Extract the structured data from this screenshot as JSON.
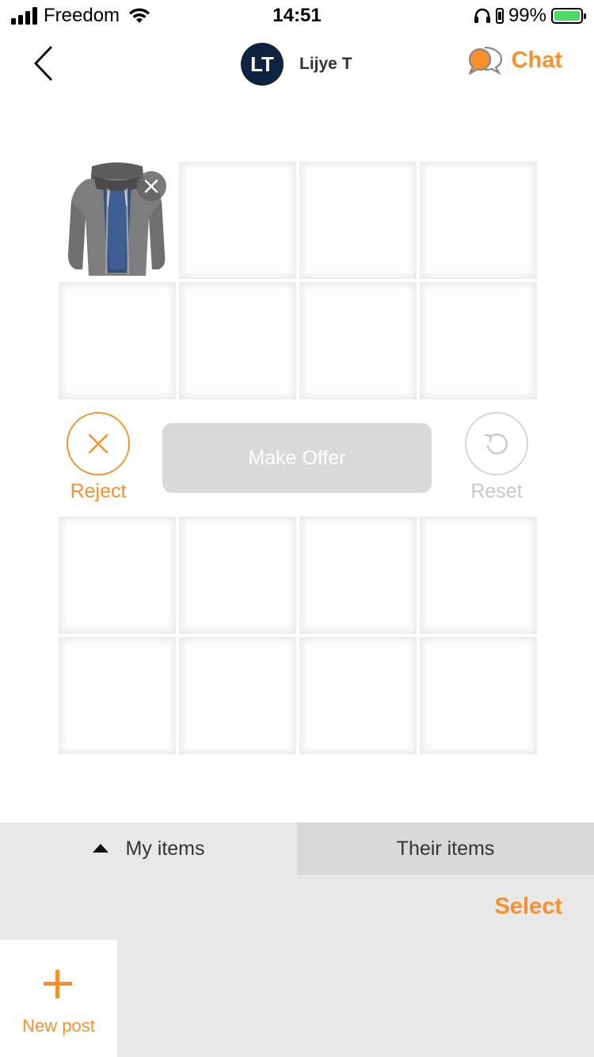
{
  "status_bar": {
    "carrier": "Freedom",
    "time": "14:51",
    "battery_percent": "99%",
    "battery_level": 0.99,
    "icons": [
      "signal-icon",
      "wifi-icon",
      "headphones-icon",
      "orientation-lock-icon",
      "battery-charging-icon"
    ]
  },
  "nav": {
    "back_icon": "chevron-left-icon",
    "avatar_initials": "LT",
    "user_name": "Lijye T",
    "chat_label": "Chat",
    "chat_icon": "chat-bubbles-icon"
  },
  "offer_grid": {
    "items": [
      {
        "image": "grey-zip-jacket",
        "removable": true
      }
    ],
    "total_slots": 8
  },
  "actions": {
    "reject_label": "Reject",
    "make_offer_label": "Make Offer",
    "reset_label": "Reset"
  },
  "their_grid": {
    "total_slots": 8
  },
  "bottom_panel": {
    "tabs": [
      {
        "label": "My items",
        "active": true
      },
      {
        "label": "Their items",
        "active": false
      }
    ],
    "select_label": "Select",
    "new_post_label": "New post"
  },
  "colors": {
    "accent": "#f7912b",
    "avatar_bg": "#0d2340",
    "disabled_button": "#d9d9d9",
    "panel_bg": "#e8e8e8",
    "inactive_tab": "#d9d9d9",
    "battery_green": "#4cd964"
  }
}
